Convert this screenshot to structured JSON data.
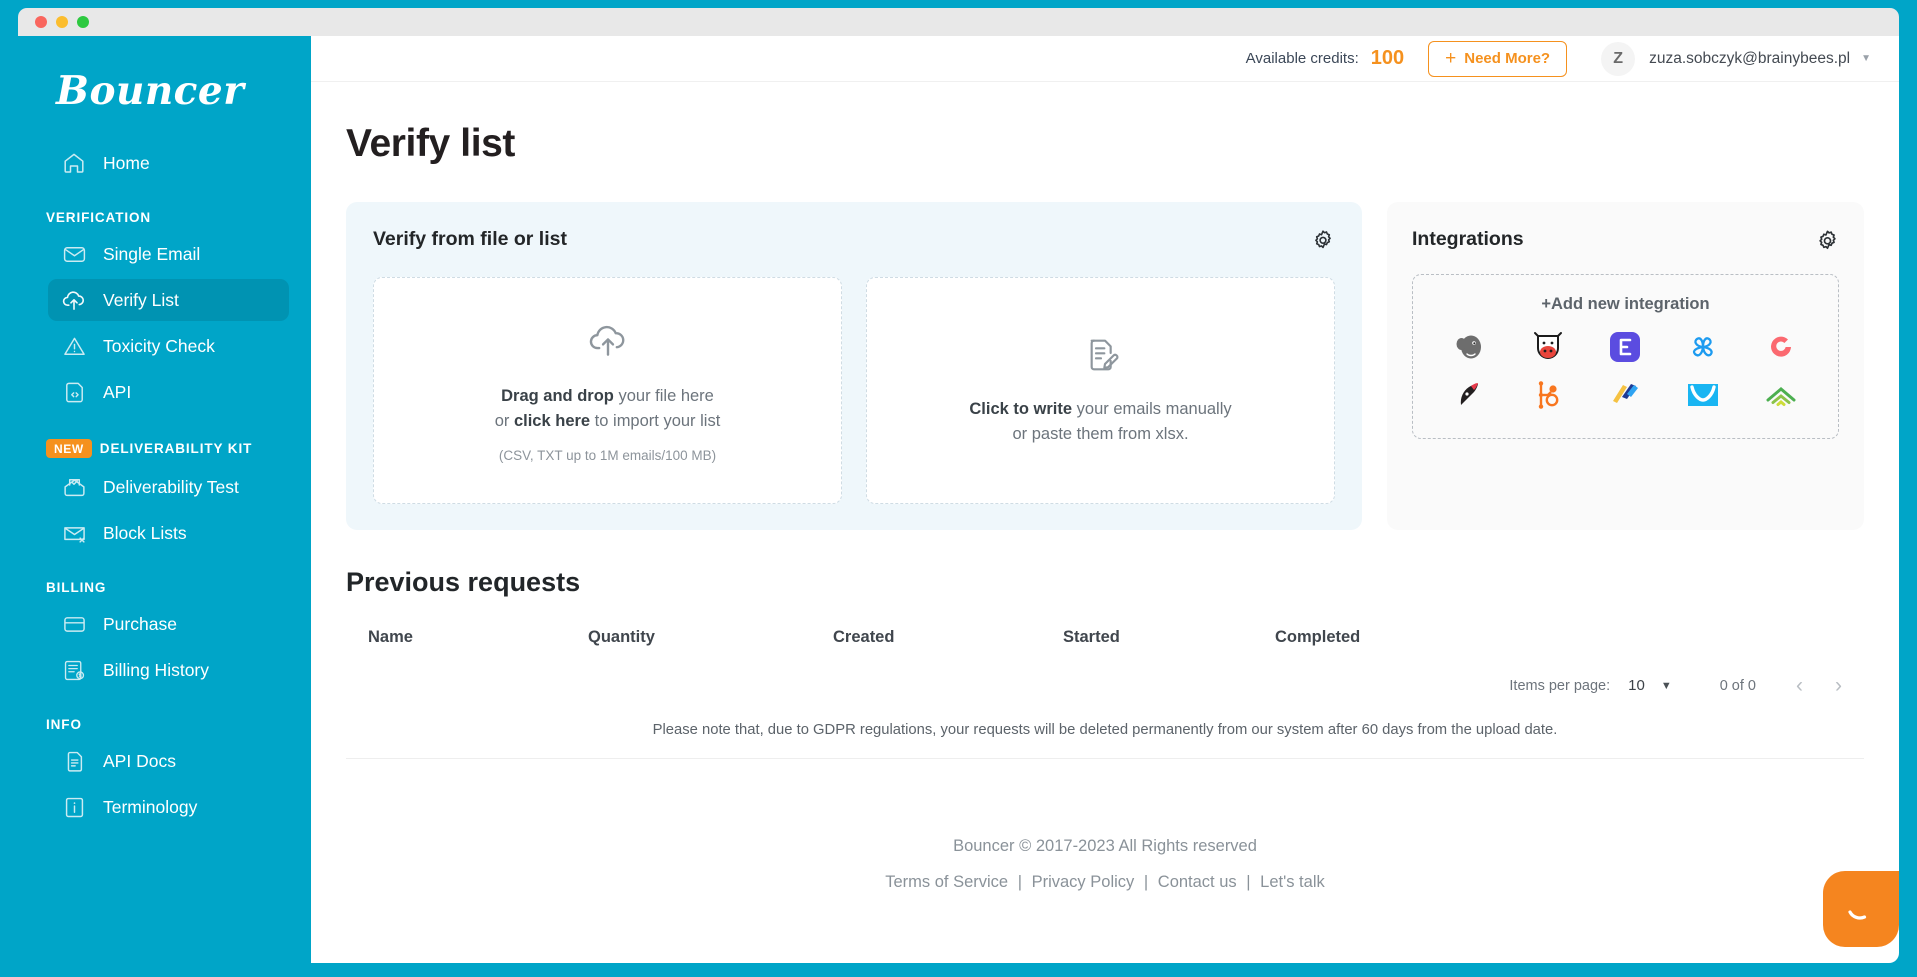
{
  "window": {
    "traffic_lights": [
      "close",
      "minimize",
      "maximize"
    ]
  },
  "sidebar": {
    "brand": "Bouncer",
    "home": {
      "label": "Home",
      "icon": "home-icon"
    },
    "groups": [
      {
        "label": "VERIFICATION",
        "badge": "",
        "items": [
          {
            "label": "Single Email",
            "icon": "envelope-icon",
            "active": false
          },
          {
            "label": "Verify List",
            "icon": "cloud-upload-icon",
            "active": true
          },
          {
            "label": "Toxicity Check",
            "icon": "warning-triangle-icon",
            "active": false
          },
          {
            "label": "API",
            "icon": "code-brackets-icon",
            "active": false
          }
        ]
      },
      {
        "label": "DELIVERABILITY KIT",
        "badge": "NEW",
        "items": [
          {
            "label": "Deliverability Test",
            "icon": "envelope-check-icon",
            "active": false
          },
          {
            "label": "Block Lists",
            "icon": "envelope-x-icon",
            "active": false
          }
        ]
      },
      {
        "label": "BILLING",
        "badge": "",
        "items": [
          {
            "label": "Purchase",
            "icon": "credit-card-icon",
            "active": false
          },
          {
            "label": "Billing History",
            "icon": "invoice-dollar-icon",
            "active": false
          }
        ]
      },
      {
        "label": "INFO",
        "badge": "",
        "items": [
          {
            "label": "API Docs",
            "icon": "document-lines-icon",
            "active": false
          },
          {
            "label": "Terminology",
            "icon": "info-icon",
            "active": false
          }
        ]
      }
    ]
  },
  "topbar": {
    "credits_label": "Available credits:",
    "credits_value": "100",
    "need_more_label": "Need More?",
    "need_more_plus": "+",
    "avatar_initial": "Z",
    "user_email": "zuza.sobczyk@brainybees.pl",
    "caret": "▼"
  },
  "page": {
    "title": "Verify list"
  },
  "verify_panel": {
    "title": "Verify from file or list",
    "gear_icon": "gear-icon",
    "dropzone_file": {
      "icon": "cloud-upload-icon",
      "line1_bold": "Drag and drop",
      "line1_rest": " your file here",
      "line2_pre": "or ",
      "line2_bold": "click here",
      "line2_rest": " to import your list",
      "sub": "(CSV, TXT up to 1M emails/100 MB)"
    },
    "dropzone_manual": {
      "icon": "document-pencil-icon",
      "line1_bold": "Click to write",
      "line1_rest": " your emails manually",
      "line2": "or paste them from xlsx."
    }
  },
  "integrations_panel": {
    "title": "Integrations",
    "gear_icon": "gear-icon",
    "add_label": "Add new integration",
    "add_plus": "+",
    "icons": [
      {
        "name": "mailchimp-icon",
        "color": "#6b6b6b"
      },
      {
        "name": "moosend-icon",
        "color": "#e8453c"
      },
      {
        "name": "elastic-email-icon",
        "color": "#5b4ce0"
      },
      {
        "name": "brevo-sendinblue-icon",
        "color": "#1d9bf0"
      },
      {
        "name": "convertkit-icon",
        "color": "#fb6970"
      },
      {
        "name": "klaviyo-icon",
        "color": "#231f20"
      },
      {
        "name": "hubspot-icon",
        "color": "#f8761f"
      },
      {
        "name": "mailjet-icon",
        "color": "#f5c242"
      },
      {
        "name": "campaign-monitor-icon",
        "color": "#19b5f2"
      },
      {
        "name": "mailerlite-icon",
        "color": "#4caf50"
      }
    ]
  },
  "previous_requests": {
    "title": "Previous requests",
    "columns": [
      "Name",
      "Quantity",
      "Created",
      "Started",
      "Completed"
    ],
    "rows": [],
    "paginator": {
      "items_per_page_label": "Items per page:",
      "items_per_page_value": "10",
      "dropdown_icon": "chevron-down-icon",
      "range": "0 of 0",
      "prev_icon": "chevron-left-icon",
      "next_icon": "chevron-right-icon",
      "prev_glyph": "‹",
      "next_glyph": "›",
      "caret_glyph": "▼"
    },
    "gdpr_note": "Please note that, due to GDPR regulations, your requests will be deleted permanently from our system after 60 days from the upload date."
  },
  "footer": {
    "copyright": "Bouncer © 2017-2023 All Rights reserved",
    "links": [
      "Terms of Service",
      "Privacy Policy",
      "Contact us",
      "Let's talk"
    ],
    "separator": "|"
  },
  "chat": {
    "icon": "chat-smile-icon",
    "color": "#f5851f"
  },
  "colors": {
    "brand_teal": "#00a5c8",
    "sidebar_active": "#0093b2",
    "accent_orange": "#f5911e",
    "panel_blue": "#eff7fb",
    "panel_grey": "#fafafa"
  }
}
